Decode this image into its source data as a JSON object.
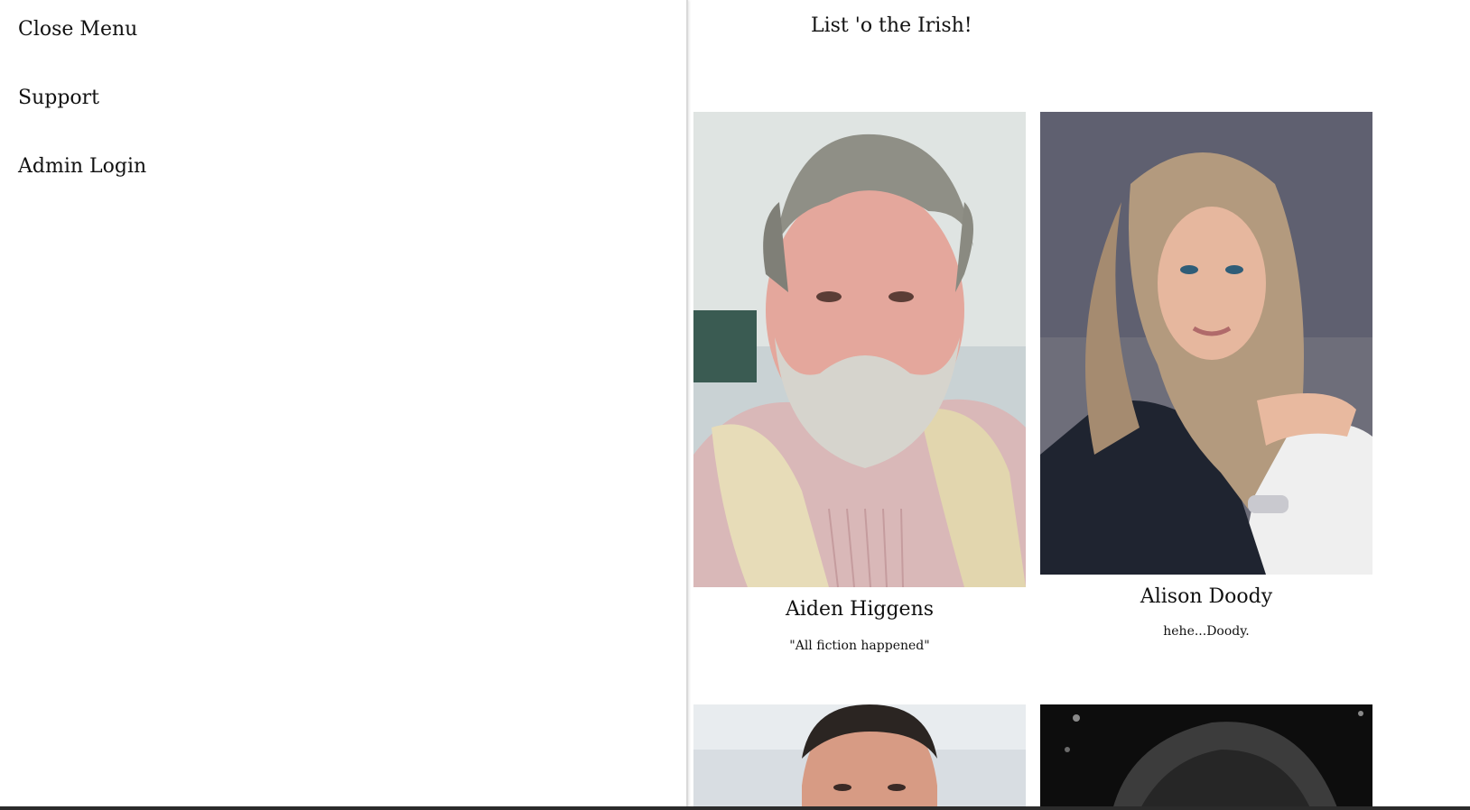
{
  "sidebar": {
    "items": [
      {
        "label": "Close Menu"
      },
      {
        "label": "Support"
      },
      {
        "label": "Admin Login"
      }
    ]
  },
  "main": {
    "title": "List 'o the Irish!",
    "cards": [
      {
        "name": "Aiden Higgens",
        "quote": "\"All fiction happened\""
      },
      {
        "name": "Alison Doody",
        "quote": "hehe...Doody."
      },
      {
        "name": "",
        "quote": ""
      },
      {
        "name": "",
        "quote": ""
      }
    ]
  },
  "colors": {
    "text": "#111111",
    "background": "#ffffff",
    "divider": "#d9d9d9"
  }
}
